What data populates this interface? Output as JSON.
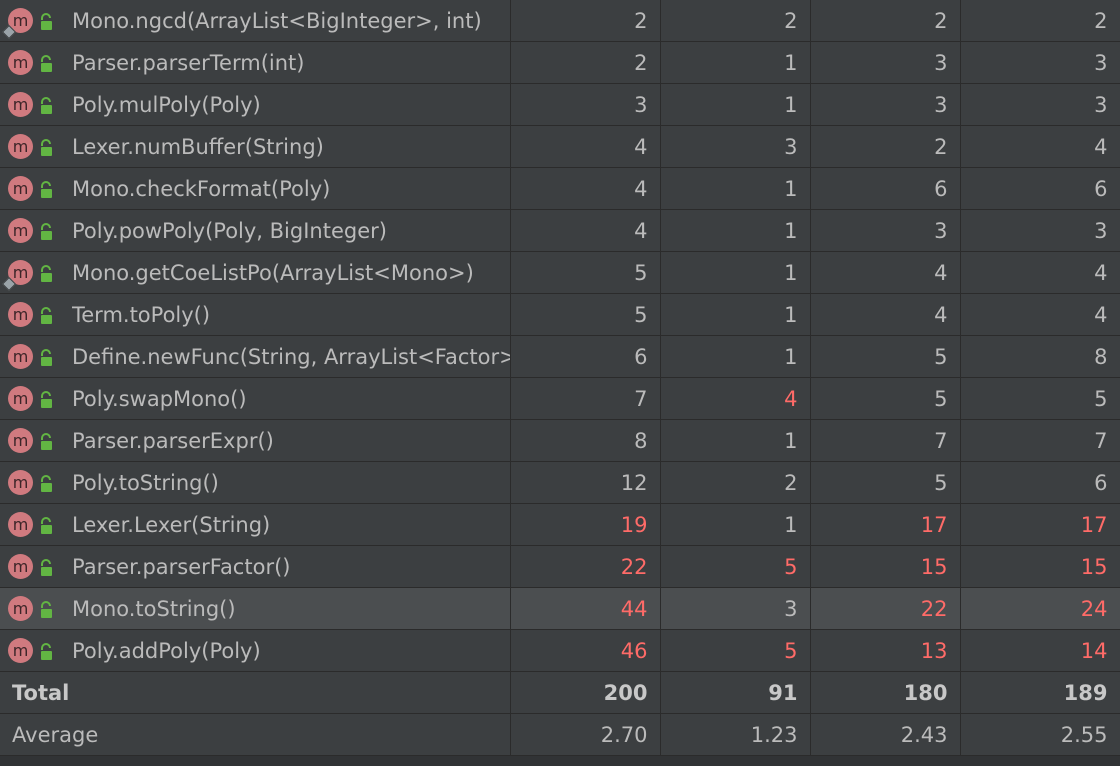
{
  "rows": [
    {
      "name": "Mono.ngcd(ArrayList<BigInteger>, int)",
      "v1": "2",
      "v2": "2",
      "v3": "2",
      "v4": "2",
      "red": [
        false,
        false,
        false,
        false
      ],
      "diamond": true
    },
    {
      "name": "Parser.parserTerm(int)",
      "v1": "2",
      "v2": "1",
      "v3": "3",
      "v4": "3",
      "red": [
        false,
        false,
        false,
        false
      ],
      "diamond": false
    },
    {
      "name": "Poly.mulPoly(Poly)",
      "v1": "3",
      "v2": "1",
      "v3": "3",
      "v4": "3",
      "red": [
        false,
        false,
        false,
        false
      ],
      "diamond": false
    },
    {
      "name": "Lexer.numBuffer(String)",
      "v1": "4",
      "v2": "3",
      "v3": "2",
      "v4": "4",
      "red": [
        false,
        false,
        false,
        false
      ],
      "diamond": false
    },
    {
      "name": "Mono.checkFormat(Poly)",
      "v1": "4",
      "v2": "1",
      "v3": "6",
      "v4": "6",
      "red": [
        false,
        false,
        false,
        false
      ],
      "diamond": false
    },
    {
      "name": "Poly.powPoly(Poly, BigInteger)",
      "v1": "4",
      "v2": "1",
      "v3": "3",
      "v4": "3",
      "red": [
        false,
        false,
        false,
        false
      ],
      "diamond": false
    },
    {
      "name": "Mono.getCoeListPo(ArrayList<Mono>)",
      "v1": "5",
      "v2": "1",
      "v3": "4",
      "v4": "4",
      "red": [
        false,
        false,
        false,
        false
      ],
      "diamond": true
    },
    {
      "name": "Term.toPoly()",
      "v1": "5",
      "v2": "1",
      "v3": "4",
      "v4": "4",
      "red": [
        false,
        false,
        false,
        false
      ],
      "diamond": false
    },
    {
      "name": "Define.newFunc(String, ArrayList<Factor>",
      "v1": "6",
      "v2": "1",
      "v3": "5",
      "v4": "8",
      "red": [
        false,
        false,
        false,
        false
      ],
      "diamond": false
    },
    {
      "name": "Poly.swapMono()",
      "v1": "7",
      "v2": "4",
      "v3": "5",
      "v4": "5",
      "red": [
        false,
        true,
        false,
        false
      ],
      "diamond": false
    },
    {
      "name": "Parser.parserExpr()",
      "v1": "8",
      "v2": "1",
      "v3": "7",
      "v4": "7",
      "red": [
        false,
        false,
        false,
        false
      ],
      "diamond": false
    },
    {
      "name": "Poly.toString()",
      "v1": "12",
      "v2": "2",
      "v3": "5",
      "v4": "6",
      "red": [
        false,
        false,
        false,
        false
      ],
      "diamond": false
    },
    {
      "name": "Lexer.Lexer(String)",
      "v1": "19",
      "v2": "1",
      "v3": "17",
      "v4": "17",
      "red": [
        true,
        false,
        true,
        true
      ],
      "diamond": false
    },
    {
      "name": "Parser.parserFactor()",
      "v1": "22",
      "v2": "5",
      "v3": "15",
      "v4": "15",
      "red": [
        true,
        true,
        true,
        true
      ],
      "diamond": false
    },
    {
      "name": "Mono.toString()",
      "v1": "44",
      "v2": "3",
      "v3": "22",
      "v4": "24",
      "red": [
        true,
        false,
        true,
        true
      ],
      "diamond": false,
      "selected": true
    },
    {
      "name": "Poly.addPoly(Poly)",
      "v1": "46",
      "v2": "5",
      "v3": "13",
      "v4": "14",
      "red": [
        true,
        true,
        true,
        true
      ],
      "diamond": false
    }
  ],
  "total": {
    "label": "Total",
    "v1": "200",
    "v2": "91",
    "v3": "180",
    "v4": "189"
  },
  "average": {
    "label": "Average",
    "v1": "2.70",
    "v2": "1.23",
    "v3": "2.43",
    "v4": "2.55"
  },
  "icons": {
    "method": "method-icon",
    "access": "lock-open-icon",
    "badge": "m"
  },
  "colors": {
    "red": "#ff6b68",
    "method_badge": "#d07a7f",
    "lock": "#62b543"
  }
}
